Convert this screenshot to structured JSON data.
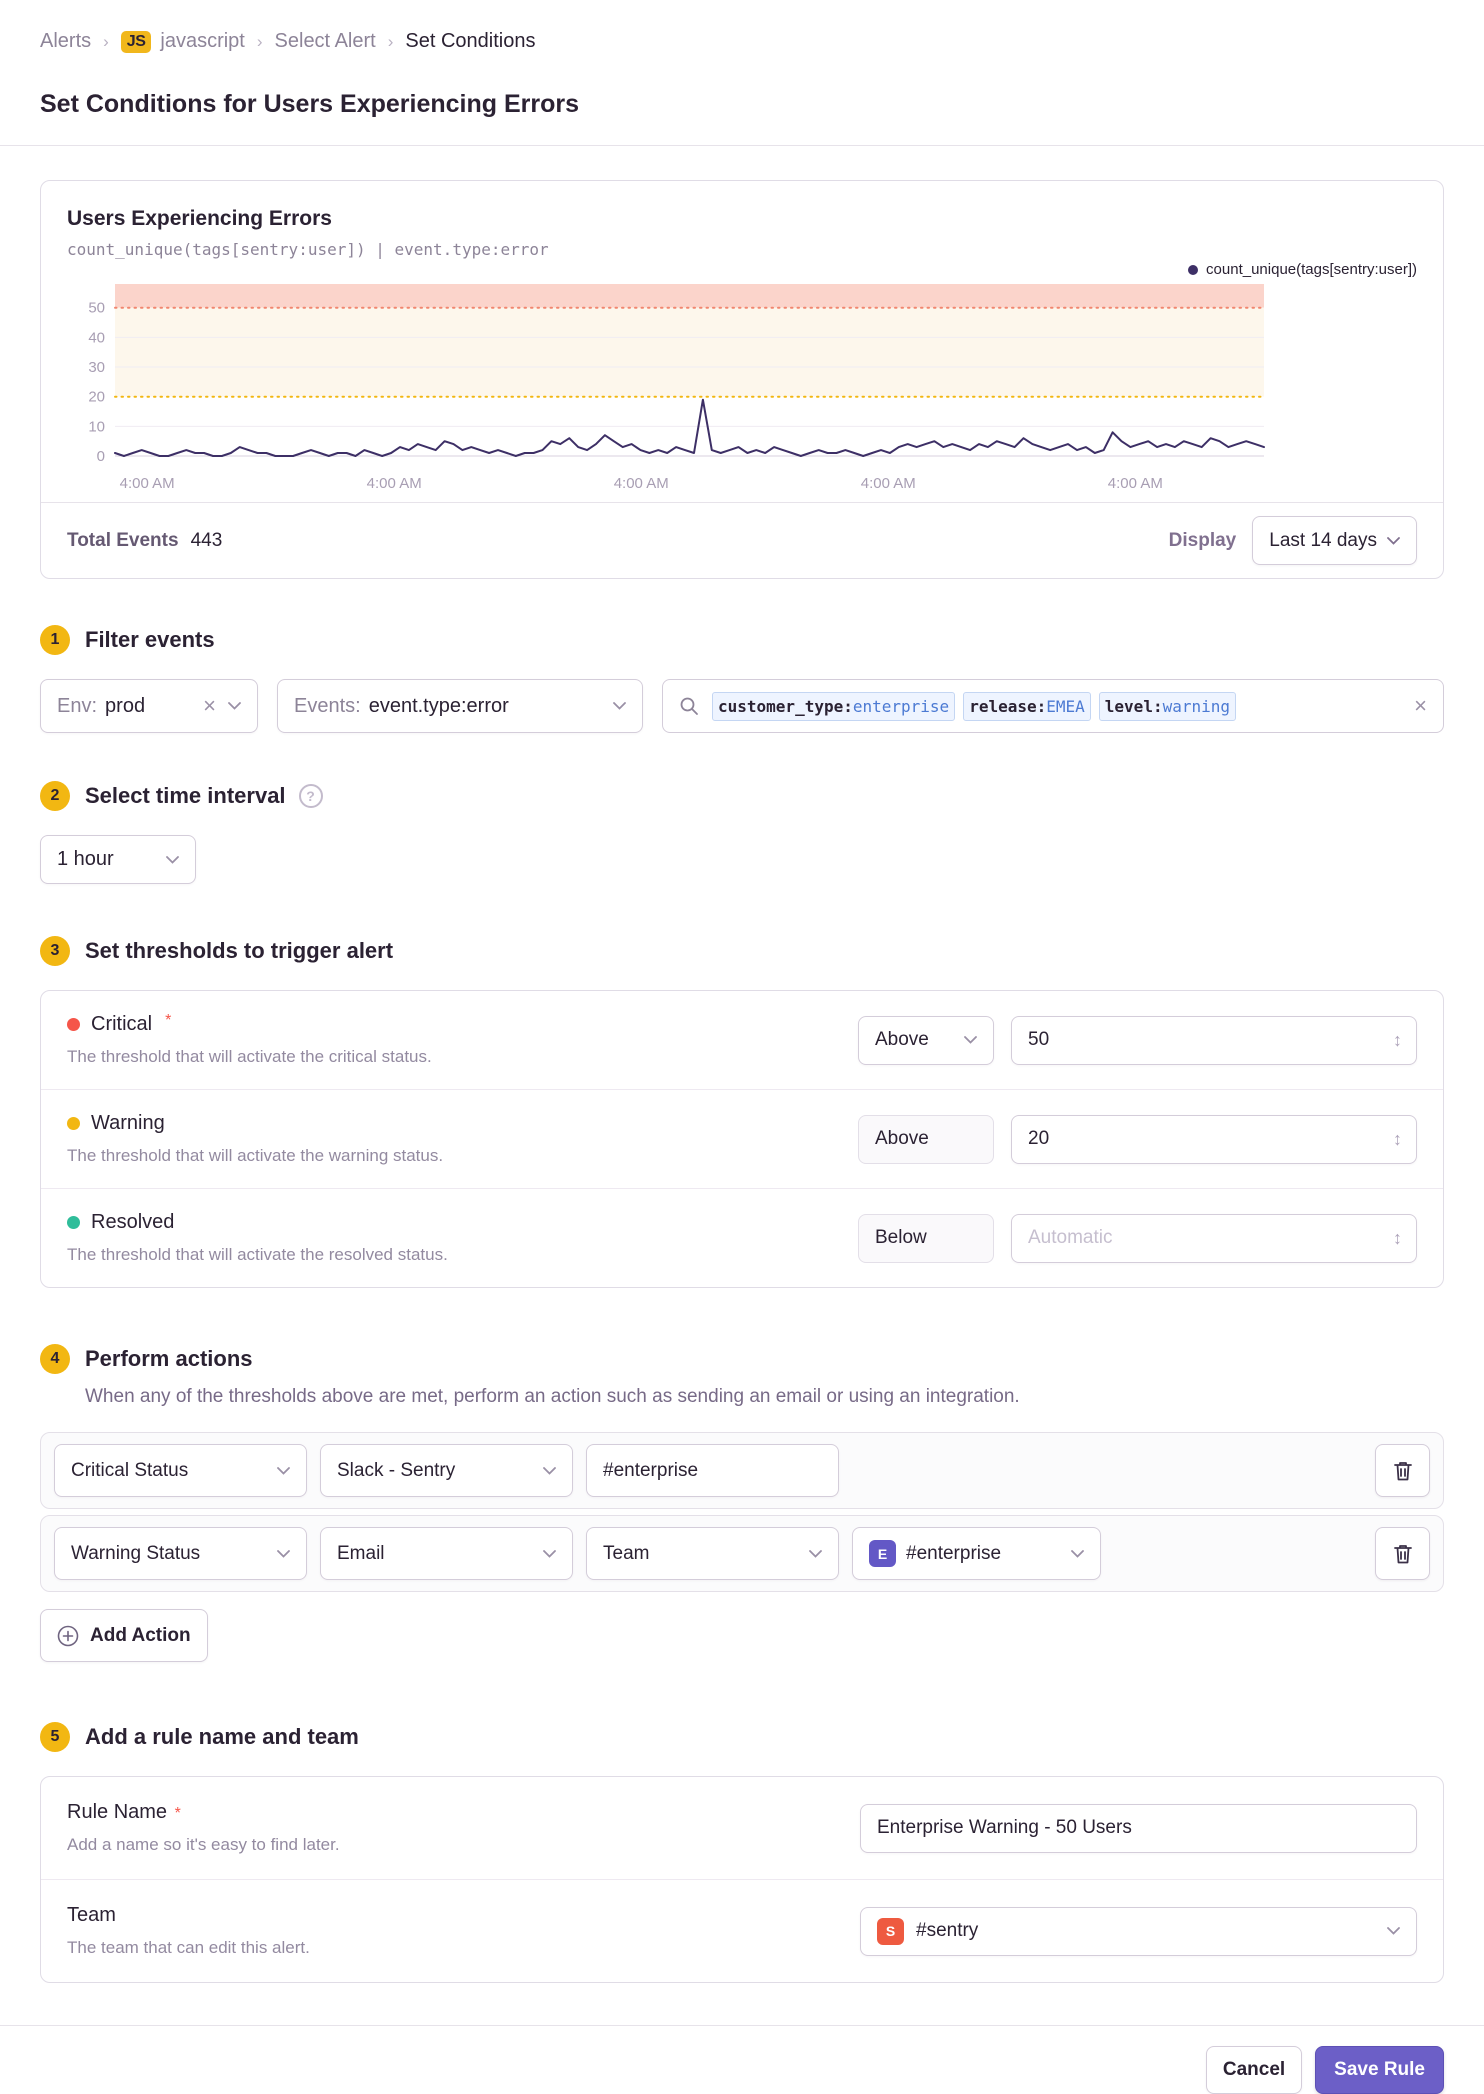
{
  "breadcrumb": {
    "items": [
      "Alerts",
      "javascript",
      "Select Alert",
      "Set Conditions"
    ],
    "project_badge": "JS",
    "separator": "›"
  },
  "page": {
    "title": "Set Conditions for Users Experiencing Errors"
  },
  "chart_card": {
    "title": "Users Experiencing Errors",
    "subtitle": "count_unique(tags[sentry:user]) | event.type:error",
    "legend": "count_unique(tags[sentry:user])",
    "total_events_label": "Total Events",
    "total_events_value": "443",
    "display_label": "Display",
    "display_value": "Last 14 days",
    "chart_data": {
      "type": "line",
      "title": "Users Experiencing Errors",
      "xlabel": "",
      "ylabel": "",
      "ylim": [
        0,
        58
      ],
      "yticks": [
        0,
        10,
        20,
        30,
        40,
        50
      ],
      "xticks": [
        "4:00 AM",
        "4:00 AM",
        "4:00 AM",
        "4:00 AM",
        "4:00 AM"
      ],
      "xtick_fractions": [
        0.028,
        0.243,
        0.458,
        0.673,
        0.888
      ],
      "grid": "horizontal",
      "legend_position": "top-right",
      "thresholds": {
        "critical": 50,
        "warning": 20
      },
      "series": [
        {
          "name": "count_unique(tags[sentry:user])",
          "values": [
            1,
            0,
            1,
            2,
            1,
            0,
            0,
            1,
            2,
            1,
            1,
            0,
            0,
            1,
            3,
            2,
            1,
            1,
            0,
            0,
            0,
            1,
            2,
            1,
            0,
            1,
            1,
            0,
            2,
            1,
            0,
            1,
            3,
            2,
            4,
            3,
            2,
            5,
            4,
            2,
            3,
            2,
            1,
            2,
            1,
            0,
            1,
            1,
            2,
            5,
            4,
            6,
            3,
            2,
            4,
            7,
            5,
            3,
            4,
            2,
            1,
            2,
            1,
            3,
            2,
            1,
            19,
            2,
            1,
            2,
            3,
            1,
            2,
            1,
            3,
            2,
            1,
            0,
            1,
            2,
            1,
            1,
            2,
            1,
            0,
            1,
            2,
            1,
            3,
            4,
            3,
            4,
            5,
            3,
            4,
            3,
            2,
            4,
            3,
            5,
            4,
            3,
            6,
            4,
            3,
            2,
            3,
            4,
            2,
            3,
            1,
            2,
            8,
            5,
            3,
            4,
            5,
            3,
            4,
            3,
            5,
            4,
            3,
            6,
            5,
            3,
            4,
            5,
            4,
            3
          ]
        }
      ],
      "colors": {
        "series": "#3d2f66",
        "critical_band": "#fbd4cb",
        "warning_band": "#fdf7ec",
        "critical_line": "#f1866f",
        "warning_line": "#f2b712",
        "grid": "#f0ecf3",
        "axis": "#d9d2df",
        "tick_text": "#a89eb3"
      }
    }
  },
  "filter": {
    "step": "1",
    "title": "Filter events",
    "env": {
      "label": "Env:",
      "value": "prod"
    },
    "events": {
      "label": "Events:",
      "value": "event.type:error"
    },
    "search": {
      "tokens": [
        {
          "key": "customer_type:",
          "value": "enterprise"
        },
        {
          "key": "release:",
          "value": "EMEA"
        },
        {
          "key": "level:",
          "value": "warning"
        }
      ]
    }
  },
  "interval": {
    "step": "2",
    "title": "Select time interval",
    "value": "1 hour"
  },
  "thresholds": {
    "step": "3",
    "title": "Set thresholds to trigger alert",
    "rows": [
      {
        "name": "Critical",
        "required": "*",
        "description": "The threshold that will activate the critical status.",
        "condition": "Above",
        "value": "50",
        "dot_color": "#f55549"
      },
      {
        "name": "Warning",
        "description": "The threshold that will activate the warning status.",
        "condition": "Above",
        "value": "20",
        "dot_color": "#f2b712"
      },
      {
        "name": "Resolved",
        "description": "The threshold that will activate the resolved status.",
        "condition": "Below",
        "value": "",
        "placeholder": "Automatic",
        "dot_color": "#2fbd9a"
      }
    ]
  },
  "actions": {
    "step": "4",
    "title": "Perform actions",
    "description": "When any of the thresholds above are met, perform an action such as sending an email or using an integration.",
    "rows": [
      {
        "status": "Critical Status",
        "service": "Slack - Sentry",
        "target": "#enterprise"
      },
      {
        "status": "Warning Status",
        "service": "Email",
        "target_type": "Team",
        "team_badge": "E",
        "team": "#enterprise",
        "team_badge_color": "#6358c6"
      }
    ],
    "add_label": "Add Action"
  },
  "rule": {
    "step": "5",
    "title": "Add a rule name and team",
    "name_label": "Rule Name",
    "name_required": "*",
    "name_description": "Add a name so it's easy to find later.",
    "name_value": "Enterprise Warning - 50 Users",
    "team_label": "Team",
    "team_description": "The team that can edit this alert.",
    "team_badge": "S",
    "team_badge_color": "#ee5a40",
    "team_value": "#sentry"
  },
  "footer": {
    "cancel": "Cancel",
    "save": "Save Rule"
  },
  "colors": {
    "accent_purple": "#6c5fc7",
    "step_badge_yellow": "#f2b712",
    "project_badge_yellow": "#f1b71c",
    "critical_red": "#f55549",
    "warning_yellow": "#f2b712",
    "resolved_green": "#2fbd9a"
  }
}
